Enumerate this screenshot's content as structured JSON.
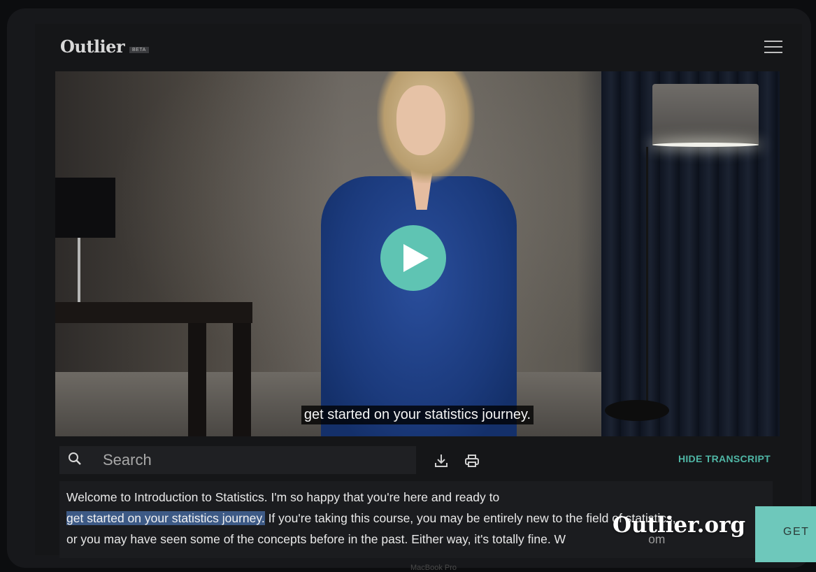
{
  "app": {
    "logo": "Outlier",
    "badge": "BETA"
  },
  "video": {
    "caption": "get started on your statistics journey."
  },
  "toolbar": {
    "search_placeholder": "Search",
    "hide_transcript_label": "HIDE TRANSCRIPT"
  },
  "transcript": {
    "line1": "Welcome to Introduction to Statistics. I'm so happy that you're here and ready to",
    "line2_highlight": "get started on your statistics journey.",
    "line2_rest": " If you're taking this course, you may be entirely new to the field of statistics,",
    "line3": "or you may have seen some of the concepts before in the past. Either way, it's totally fine. W",
    "line3_tail": "om"
  },
  "device_label": "MacBook Pro",
  "watermark": "Outlier.org",
  "cta": {
    "label": "GET"
  },
  "colors": {
    "accent": "#5fc4b3",
    "highlight": "#3d5a86"
  }
}
